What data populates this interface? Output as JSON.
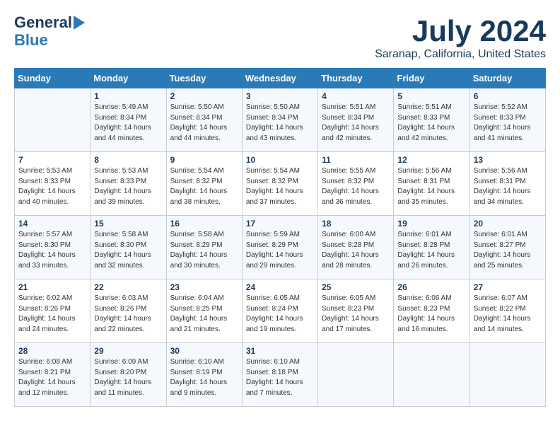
{
  "header": {
    "logo_line1": "General",
    "logo_line2": "Blue",
    "main_title": "July 2024",
    "subtitle": "Saranap, California, United States"
  },
  "columns": [
    "Sunday",
    "Monday",
    "Tuesday",
    "Wednesday",
    "Thursday",
    "Friday",
    "Saturday"
  ],
  "weeks": [
    [
      {
        "day": "",
        "info": ""
      },
      {
        "day": "1",
        "info": "Sunrise: 5:49 AM\nSunset: 8:34 PM\nDaylight: 14 hours\nand 44 minutes."
      },
      {
        "day": "2",
        "info": "Sunrise: 5:50 AM\nSunset: 8:34 PM\nDaylight: 14 hours\nand 44 minutes."
      },
      {
        "day": "3",
        "info": "Sunrise: 5:50 AM\nSunset: 8:34 PM\nDaylight: 14 hours\nand 43 minutes."
      },
      {
        "day": "4",
        "info": "Sunrise: 5:51 AM\nSunset: 8:34 PM\nDaylight: 14 hours\nand 42 minutes."
      },
      {
        "day": "5",
        "info": "Sunrise: 5:51 AM\nSunset: 8:33 PM\nDaylight: 14 hours\nand 42 minutes."
      },
      {
        "day": "6",
        "info": "Sunrise: 5:52 AM\nSunset: 8:33 PM\nDaylight: 14 hours\nand 41 minutes."
      }
    ],
    [
      {
        "day": "7",
        "info": "Sunrise: 5:53 AM\nSunset: 8:33 PM\nDaylight: 14 hours\nand 40 minutes."
      },
      {
        "day": "8",
        "info": "Sunrise: 5:53 AM\nSunset: 8:33 PM\nDaylight: 14 hours\nand 39 minutes."
      },
      {
        "day": "9",
        "info": "Sunrise: 5:54 AM\nSunset: 8:32 PM\nDaylight: 14 hours\nand 38 minutes."
      },
      {
        "day": "10",
        "info": "Sunrise: 5:54 AM\nSunset: 8:32 PM\nDaylight: 14 hours\nand 37 minutes."
      },
      {
        "day": "11",
        "info": "Sunrise: 5:55 AM\nSunset: 8:32 PM\nDaylight: 14 hours\nand 36 minutes."
      },
      {
        "day": "12",
        "info": "Sunrise: 5:56 AM\nSunset: 8:31 PM\nDaylight: 14 hours\nand 35 minutes."
      },
      {
        "day": "13",
        "info": "Sunrise: 5:56 AM\nSunset: 8:31 PM\nDaylight: 14 hours\nand 34 minutes."
      }
    ],
    [
      {
        "day": "14",
        "info": "Sunrise: 5:57 AM\nSunset: 8:30 PM\nDaylight: 14 hours\nand 33 minutes."
      },
      {
        "day": "15",
        "info": "Sunrise: 5:58 AM\nSunset: 8:30 PM\nDaylight: 14 hours\nand 32 minutes."
      },
      {
        "day": "16",
        "info": "Sunrise: 5:58 AM\nSunset: 8:29 PM\nDaylight: 14 hours\nand 30 minutes."
      },
      {
        "day": "17",
        "info": "Sunrise: 5:59 AM\nSunset: 8:29 PM\nDaylight: 14 hours\nand 29 minutes."
      },
      {
        "day": "18",
        "info": "Sunrise: 6:00 AM\nSunset: 8:28 PM\nDaylight: 14 hours\nand 28 minutes."
      },
      {
        "day": "19",
        "info": "Sunrise: 6:01 AM\nSunset: 8:28 PM\nDaylight: 14 hours\nand 26 minutes."
      },
      {
        "day": "20",
        "info": "Sunrise: 6:01 AM\nSunset: 8:27 PM\nDaylight: 14 hours\nand 25 minutes."
      }
    ],
    [
      {
        "day": "21",
        "info": "Sunrise: 6:02 AM\nSunset: 8:26 PM\nDaylight: 14 hours\nand 24 minutes."
      },
      {
        "day": "22",
        "info": "Sunrise: 6:03 AM\nSunset: 8:26 PM\nDaylight: 14 hours\nand 22 minutes."
      },
      {
        "day": "23",
        "info": "Sunrise: 6:04 AM\nSunset: 8:25 PM\nDaylight: 14 hours\nand 21 minutes."
      },
      {
        "day": "24",
        "info": "Sunrise: 6:05 AM\nSunset: 8:24 PM\nDaylight: 14 hours\nand 19 minutes."
      },
      {
        "day": "25",
        "info": "Sunrise: 6:05 AM\nSunset: 8:23 PM\nDaylight: 14 hours\nand 17 minutes."
      },
      {
        "day": "26",
        "info": "Sunrise: 6:06 AM\nSunset: 8:23 PM\nDaylight: 14 hours\nand 16 minutes."
      },
      {
        "day": "27",
        "info": "Sunrise: 6:07 AM\nSunset: 8:22 PM\nDaylight: 14 hours\nand 14 minutes."
      }
    ],
    [
      {
        "day": "28",
        "info": "Sunrise: 6:08 AM\nSunset: 8:21 PM\nDaylight: 14 hours\nand 12 minutes."
      },
      {
        "day": "29",
        "info": "Sunrise: 6:09 AM\nSunset: 8:20 PM\nDaylight: 14 hours\nand 11 minutes."
      },
      {
        "day": "30",
        "info": "Sunrise: 6:10 AM\nSunset: 8:19 PM\nDaylight: 14 hours\nand 9 minutes."
      },
      {
        "day": "31",
        "info": "Sunrise: 6:10 AM\nSunset: 8:18 PM\nDaylight: 14 hours\nand 7 minutes."
      },
      {
        "day": "",
        "info": ""
      },
      {
        "day": "",
        "info": ""
      },
      {
        "day": "",
        "info": ""
      }
    ]
  ]
}
